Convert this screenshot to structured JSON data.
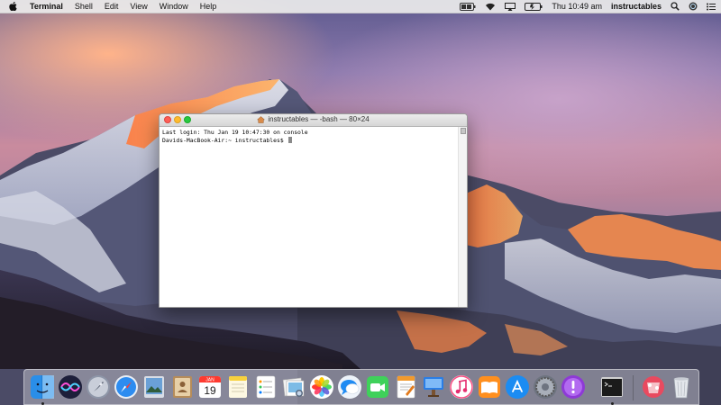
{
  "menubar": {
    "app_name": "Terminal",
    "menus": [
      "Shell",
      "Edit",
      "View",
      "Window",
      "Help"
    ],
    "clock": "Thu 10:49 am",
    "user": "instructables"
  },
  "terminal": {
    "title": "instructables — -bash — 80×24",
    "lines": [
      "Last login: Thu Jan 19 10:47:30 on console",
      "Davids-MacBook-Air:~ instructables$ "
    ]
  },
  "dock": {
    "calendar_day": "19",
    "calendar_month": "JAN"
  },
  "colors": {
    "close": "#fd5f57",
    "minimize": "#febb2e",
    "zoom": "#28c840"
  }
}
